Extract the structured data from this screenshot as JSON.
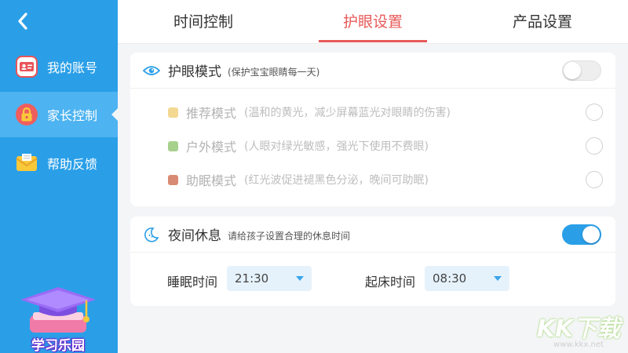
{
  "sidebar": {
    "items": [
      {
        "label": "我的账号",
        "icon": "id-card-icon",
        "active": false
      },
      {
        "label": "家长控制",
        "icon": "lock-icon",
        "active": true
      },
      {
        "label": "帮助反馈",
        "icon": "mail-icon",
        "active": false
      }
    ],
    "logo_text": "学习乐园"
  },
  "tabs": [
    {
      "label": "时间控制",
      "active": false
    },
    {
      "label": "护眼设置",
      "active": true
    },
    {
      "label": "产品设置",
      "active": false
    }
  ],
  "eye_care": {
    "title": "护眼模式",
    "subtitle": "(保护宝宝眼睛每一天)",
    "enabled": false,
    "modes": [
      {
        "name": "推荐模式",
        "desc": "(温和的黄光，减少屏幕蓝光对眼睛的伤害)",
        "color": "#f3d891",
        "selected": false
      },
      {
        "name": "户外模式",
        "desc": "(人眼对绿光敏感，强光下使用不费眼)",
        "color": "#a8d08d",
        "selected": false
      },
      {
        "name": "助眠模式",
        "desc": "(红光波促进褪黑色分泌，晚间可助眠)",
        "color": "#d98a74",
        "selected": false
      }
    ]
  },
  "night_rest": {
    "title": "夜间休息",
    "subtitle": "请给孩子设置合理的休息时间",
    "enabled": true,
    "sleep_label": "睡眠时间",
    "sleep_value": "21:30",
    "wake_label": "起床时间",
    "wake_value": "08:30"
  },
  "watermark": {
    "big": "KK下载",
    "small": "www.kkx.net"
  },
  "colors": {
    "sidebar": "#2a9fe8",
    "accent": "#e85a5a",
    "toggle_on": "#2a9fe8"
  }
}
